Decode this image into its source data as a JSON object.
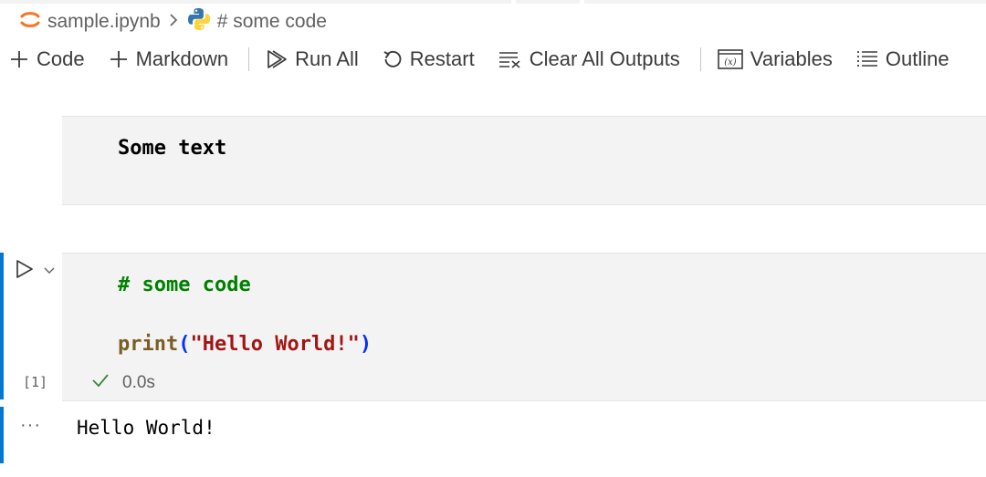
{
  "breadcrumb": {
    "file_name": "sample.ipynb",
    "separator": ">",
    "cell_label": "# some code",
    "icons": [
      "jupyter-icon",
      "python-icon",
      "chevron-right-icon"
    ]
  },
  "toolbar": {
    "code_label": "Code",
    "markdown_label": "Markdown",
    "run_all_label": "Run All",
    "restart_label": "Restart",
    "clear_outputs_label": "Clear All Outputs",
    "variables_label": "Variables",
    "outline_label": "Outline"
  },
  "cells": {
    "markdown": {
      "text": "Some text"
    },
    "code": {
      "line1": "# some code",
      "line2_func": "print",
      "line2_open": "(",
      "line2_string": "\"Hello World!\"",
      "line2_close": ")",
      "execution_count": "[1]",
      "duration": "0.0s"
    },
    "output": {
      "more_label": "···",
      "text": "Hello World!"
    }
  },
  "colors": {
    "accent": "#0078d4",
    "success": "#388a34",
    "comment": "#008000",
    "string": "#a31515",
    "function": "#795e26",
    "jupyter_orange": "#f37726"
  }
}
